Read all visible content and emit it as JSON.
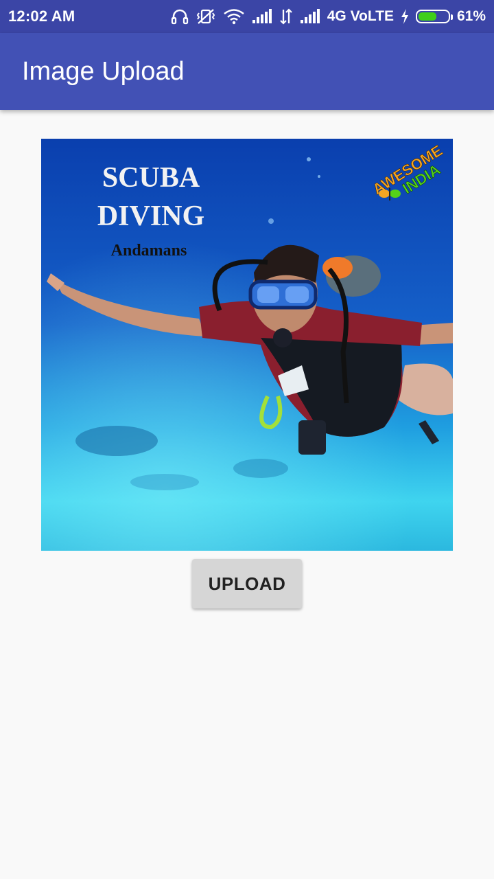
{
  "status_bar": {
    "time": "12:02 AM",
    "network": "4G VoLTE",
    "battery_percent": "61%",
    "battery_level": 0.61,
    "icons": [
      "headset-icon",
      "vibrate-off-icon",
      "wifi-icon",
      "signal-icon",
      "data-arrows-icon",
      "signal-icon",
      "charging-icon",
      "battery-icon"
    ],
    "battery_color": "#3fcf1a"
  },
  "app_bar": {
    "title": "Image Upload",
    "color": "#4251b5"
  },
  "photo": {
    "title_line1": "SCUBA",
    "title_line2": "DIVING",
    "subtitle": "Andamans",
    "logo_line1": "AWESOME",
    "logo_line2": "INDIA"
  },
  "actions": {
    "upload_label": "UPLOAD"
  }
}
